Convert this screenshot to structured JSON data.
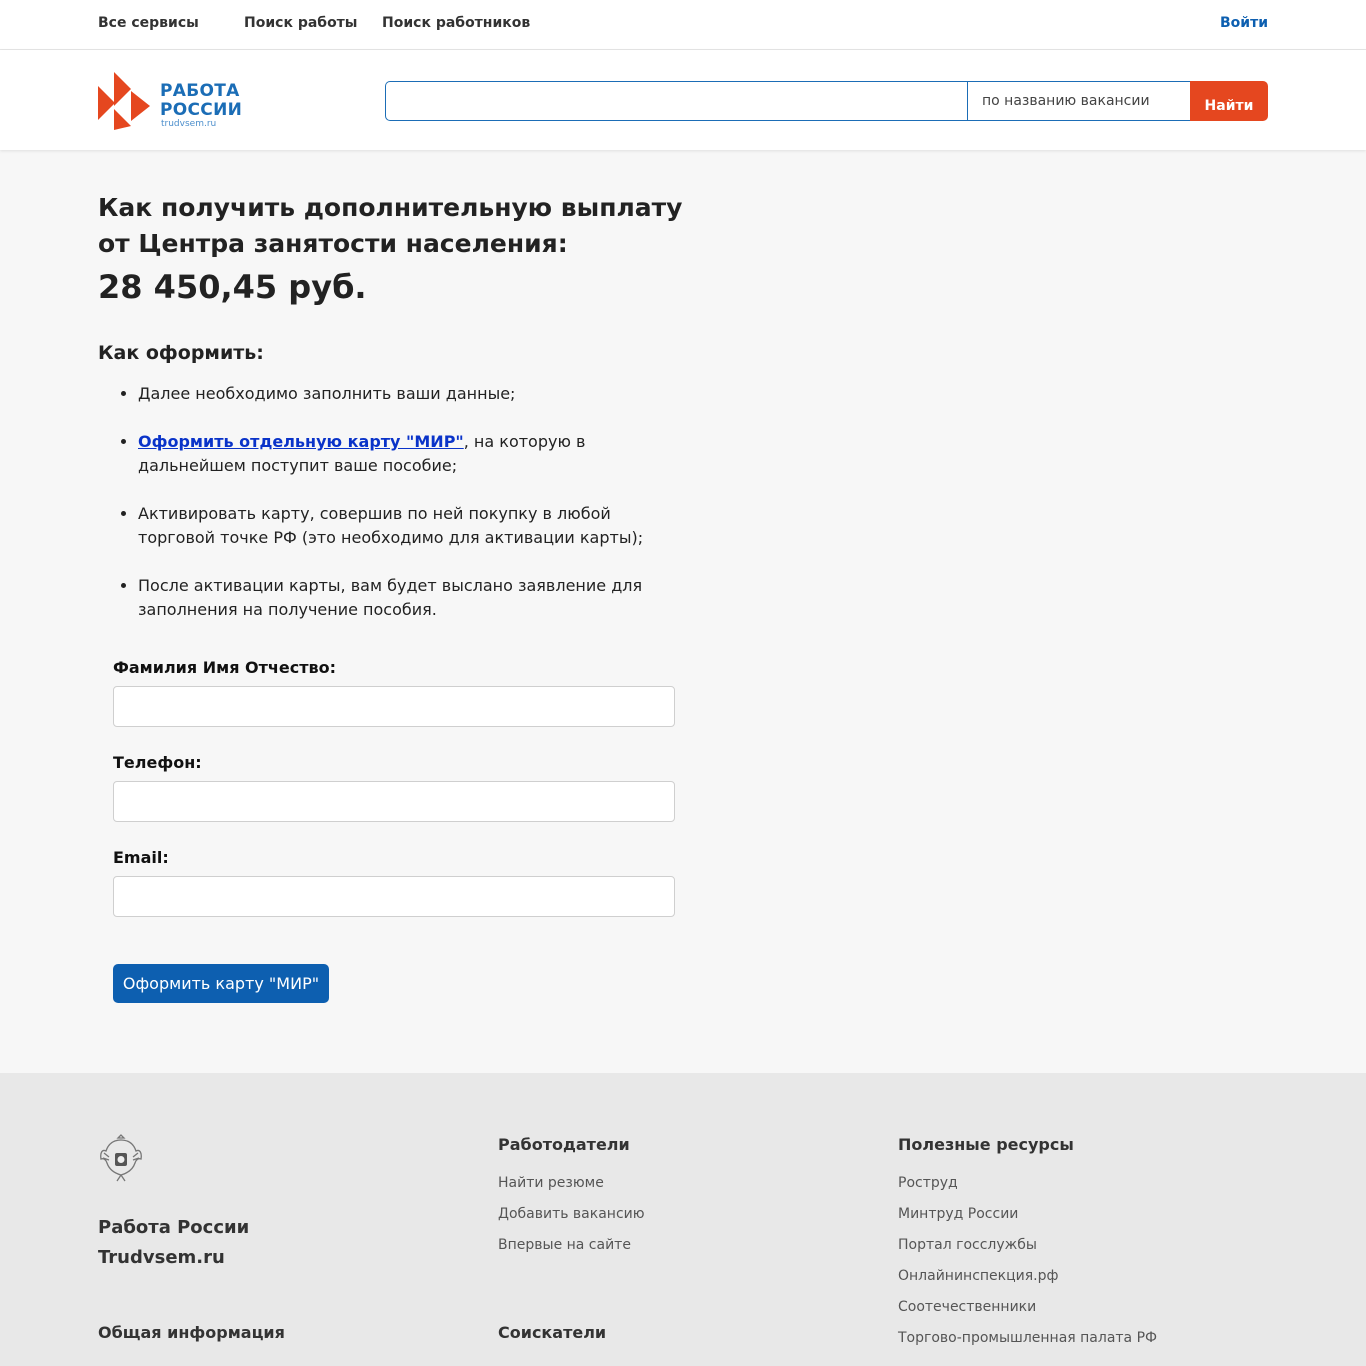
{
  "topnav": {
    "all_services": "Все сервисы",
    "job_search": "Поиск работы",
    "worker_search": "Поиск работников",
    "login": "Войти"
  },
  "logo": {
    "line1": "РАБОТА",
    "line2": "РОССИИ",
    "site": "trudvsem.ru"
  },
  "search": {
    "value": "",
    "type_label": "по названию вакансии",
    "button_label": "Найти"
  },
  "main": {
    "title": "Как получить дополнительную выплату от Центра занятости населения:",
    "amount": "28 450,45 руб.",
    "how_title": "Как оформить:",
    "steps": [
      {
        "text": "Далее необходимо заполнить ваши данные;"
      },
      {
        "link": "Оформить отдельную карту \"МИР\"",
        "text": ", на которую в дальнейшем поступит ваше пособие;"
      },
      {
        "text": "Активировать карту, совершив по ней покупку в любой торговой точке РФ (это необходимо для активации карты);"
      },
      {
        "text": "После активации карты, вам будет выслано заявление для заполнения на получение пособия."
      }
    ]
  },
  "form": {
    "name_label": "Фамилия Имя Отчество:",
    "name_value": "",
    "phone_label": "Телефон:",
    "phone_value": "",
    "email_label": "Email:",
    "email_value": "",
    "submit_label": "Оформить карту \"МИР\""
  },
  "footer": {
    "brand_line1": "Работа России",
    "brand_line2": "Trudvsem.ru",
    "general_title": "Общая информация",
    "employers_title": "Работодатели",
    "employers_links": [
      "Найти резюме",
      "Добавить вакансию",
      "Впервые на сайте"
    ],
    "seekers_title": "Соискатели",
    "resources_title": "Полезные ресурсы",
    "resources_links": [
      "Роструд",
      "Минтруд России",
      "Портал госслужбы",
      "Онлайнинспекция.рф",
      "Соотечественники",
      "Торгово-промышленная палата РФ"
    ]
  },
  "colors": {
    "brand_blue": "#1b6db6",
    "accent_red": "#e5471f",
    "button_blue": "#0d5fb0",
    "link_blue": "#0a33c9"
  }
}
